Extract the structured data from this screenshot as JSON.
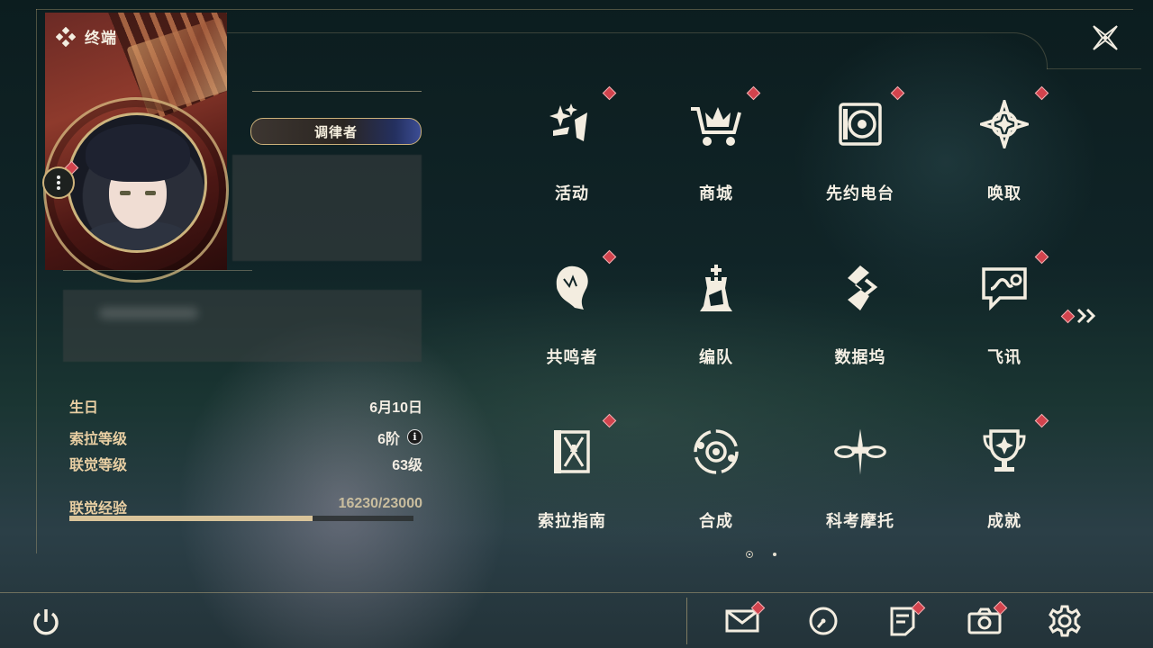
{
  "header": {
    "title": "终端"
  },
  "profile": {
    "title_badge": "调律者",
    "stats": [
      {
        "key": "生日",
        "value": "6月10日"
      },
      {
        "key": "索拉等级",
        "value": "6阶"
      },
      {
        "key": "联觉等级",
        "value": "63级"
      }
    ],
    "exp": {
      "label": "联觉经验",
      "value": "16230/23000",
      "progress": 0.7057
    }
  },
  "menu": [
    {
      "label": "活动",
      "icon": "sparkle-activity-icon",
      "badge": true
    },
    {
      "label": "商城",
      "icon": "shopping-cart-icon",
      "badge": true
    },
    {
      "label": "先约电台",
      "icon": "radio-icon",
      "badge": true
    },
    {
      "label": "唤取",
      "icon": "compass-star-icon",
      "badge": true
    },
    {
      "label": "共鸣者",
      "icon": "character-head-icon",
      "badge": true
    },
    {
      "label": "编队",
      "icon": "chess-rook-icon",
      "badge": false
    },
    {
      "label": "数据坞",
      "icon": "data-bank-icon",
      "badge": false
    },
    {
      "label": "飞讯",
      "icon": "chat-message-icon",
      "badge": true
    },
    {
      "label": "索拉指南",
      "icon": "guide-book-icon",
      "badge": true
    },
    {
      "label": "合成",
      "icon": "synthesis-icon",
      "badge": false
    },
    {
      "label": "科考摩托",
      "icon": "motorbike-icon",
      "badge": false
    },
    {
      "label": "成就",
      "icon": "trophy-icon",
      "badge": true
    }
  ],
  "colors": {
    "accent": "#cfb37c",
    "badge": "#d2434d",
    "text": "#f4efe4",
    "stat_key": "#e9cfa3"
  },
  "pager": {
    "pages": 2,
    "current": 1
  },
  "bottom_bar": [
    {
      "name": "mail-icon",
      "badge": true
    },
    {
      "name": "clock-icon",
      "badge": false
    },
    {
      "name": "notes-icon",
      "badge": true
    },
    {
      "name": "camera-icon",
      "badge": true
    },
    {
      "name": "gear-icon",
      "badge": false
    }
  ]
}
